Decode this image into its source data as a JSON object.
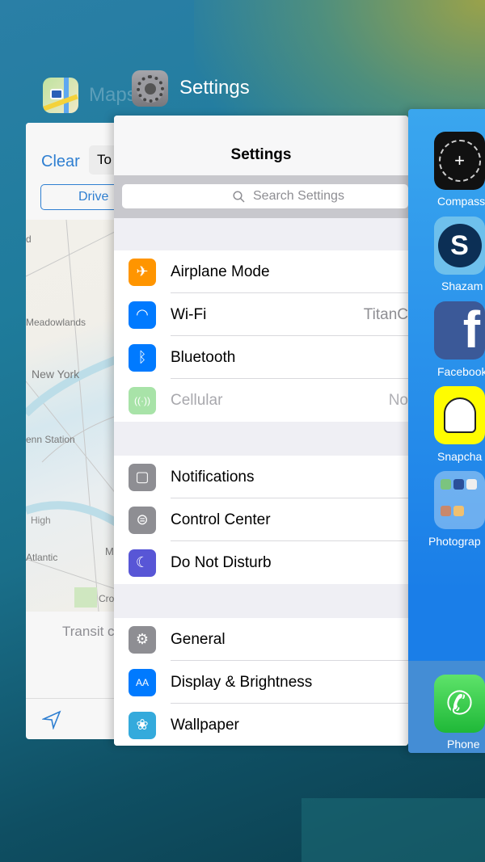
{
  "switcher": {
    "maps_label": "Maps",
    "settings_label": "Settings"
  },
  "maps": {
    "clear": "Clear",
    "to": "To",
    "drive": "Drive",
    "places": [
      "d",
      "Meadowlands",
      "New York",
      "enn Station",
      "High",
      "M",
      "Atlantic",
      "Cro"
    ],
    "transit": "Transit c"
  },
  "settings": {
    "title": "Settings",
    "search_placeholder": "Search Settings",
    "groups": [
      [
        {
          "label": "Airplane Mode",
          "icon": "airplane-icon",
          "color": "#ff9500",
          "value": ""
        },
        {
          "label": "Wi-Fi",
          "icon": "wifi-icon",
          "color": "#007aff",
          "value": "TitanC"
        },
        {
          "label": "Bluetooth",
          "icon": "bluetooth-icon",
          "color": "#007aff",
          "value": ""
        },
        {
          "label": "Cellular",
          "icon": "cellular-icon",
          "color": "#a8e3a8",
          "value": "No",
          "dimmed": true
        }
      ],
      [
        {
          "label": "Notifications",
          "icon": "notifications-icon",
          "color": "#8e8e93",
          "value": ""
        },
        {
          "label": "Control Center",
          "icon": "control-center-icon",
          "color": "#8e8e93",
          "value": ""
        },
        {
          "label": "Do Not Disturb",
          "icon": "moon-icon",
          "color": "#5856d6",
          "value": ""
        }
      ],
      [
        {
          "label": "General",
          "icon": "gear-icon",
          "color": "#8e8e93",
          "value": ""
        },
        {
          "label": "Display & Brightness",
          "icon": "display-icon",
          "color": "#007aff",
          "value": ""
        },
        {
          "label": "Wallpaper",
          "icon": "wallpaper-icon",
          "color": "#34aadc",
          "value": ""
        }
      ]
    ]
  },
  "home": {
    "apps": [
      "Compass",
      "Shazam",
      "Facebook",
      "Snapcha",
      "Photograp"
    ],
    "dock": "Phone"
  }
}
